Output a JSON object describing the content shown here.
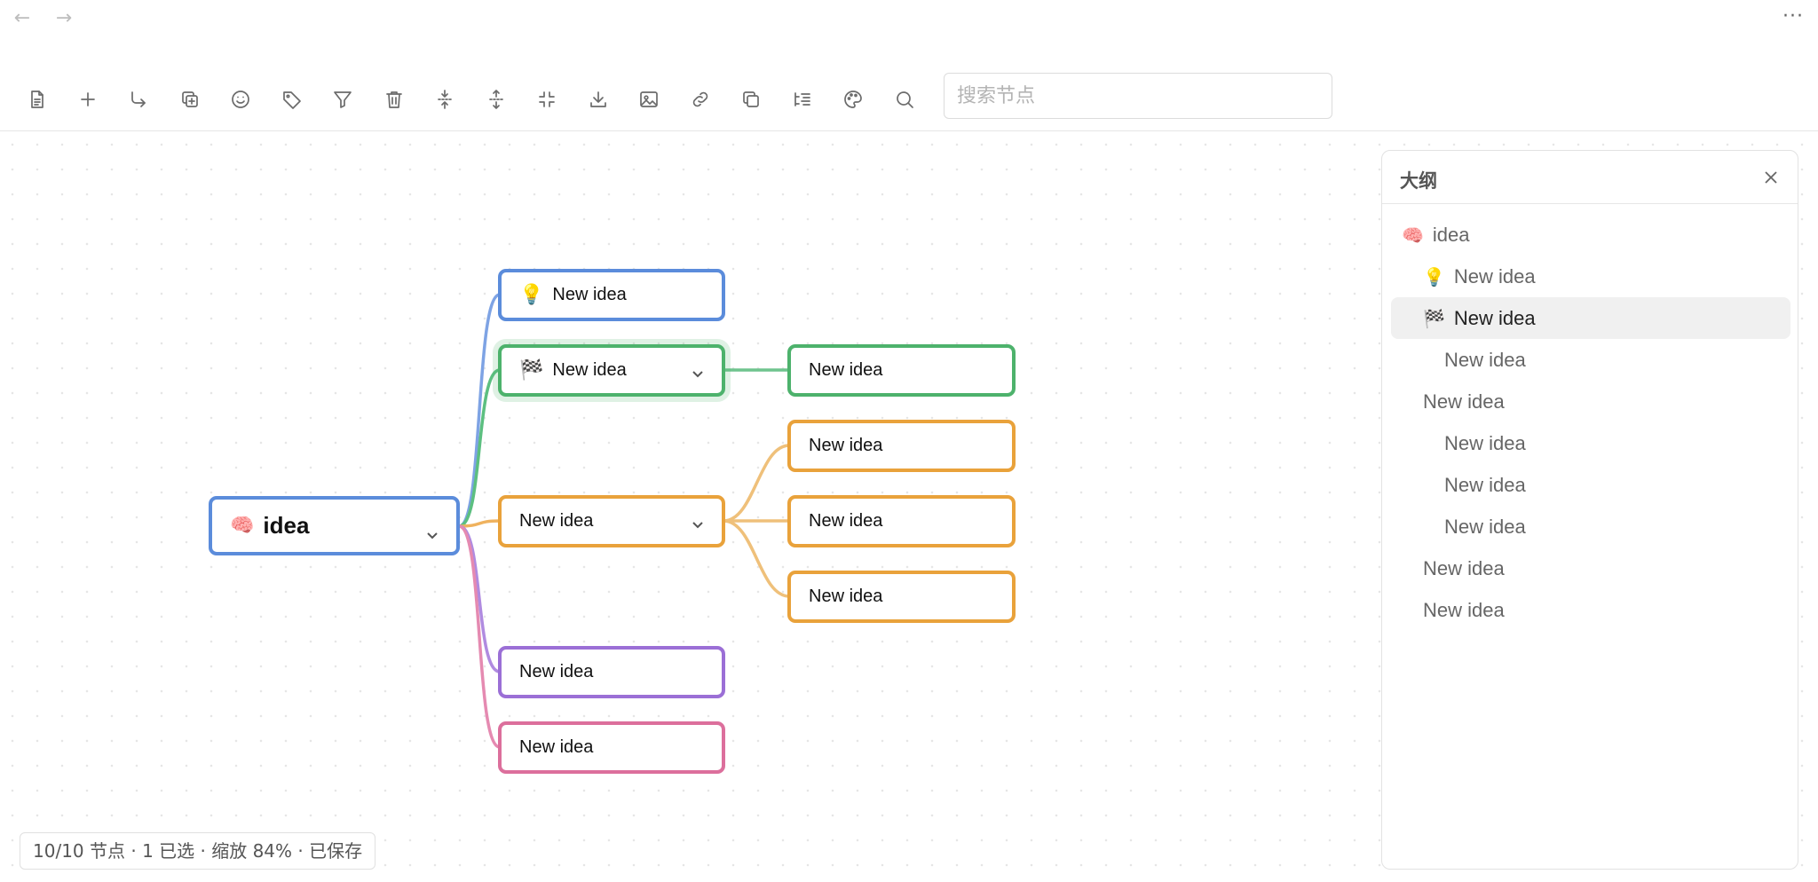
{
  "nav": {
    "back": "←",
    "forward": "→",
    "more": "···"
  },
  "toolbar": {
    "buttons": [
      {
        "name": "document-icon"
      },
      {
        "name": "add-icon"
      },
      {
        "name": "add-child-icon"
      },
      {
        "name": "duplicate-icon"
      },
      {
        "name": "emoji-icon"
      },
      {
        "name": "tag-icon"
      },
      {
        "name": "filter-icon"
      },
      {
        "name": "delete-icon"
      },
      {
        "name": "expand-icon"
      },
      {
        "name": "collapse-icon"
      },
      {
        "name": "fit-icon"
      },
      {
        "name": "download-icon"
      },
      {
        "name": "image-icon"
      },
      {
        "name": "link-icon"
      },
      {
        "name": "copy-icon"
      },
      {
        "name": "outline-icon"
      },
      {
        "name": "palette-icon"
      },
      {
        "name": "search-icon"
      }
    ],
    "search_placeholder": "搜索节点"
  },
  "mindmap": {
    "root": {
      "emoji": "🧠",
      "label": "idea",
      "color": "#5b8cdb"
    },
    "nodes": [
      {
        "emoji": "💡",
        "label": "New idea",
        "color": "#5b8cdb"
      },
      {
        "emoji": "🏁",
        "label": "New idea",
        "color": "#4db26c"
      },
      {
        "emoji": "",
        "label": "New idea",
        "color": "#e9a23b"
      },
      {
        "emoji": "",
        "label": "New idea",
        "color": "#9b6fd6"
      },
      {
        "emoji": "",
        "label": "New idea",
        "color": "#dc6f9c"
      },
      {
        "emoji": "",
        "label": "New idea",
        "color": "#4db26c"
      },
      {
        "emoji": "",
        "label": "New idea",
        "color": "#e9a23b"
      },
      {
        "emoji": "",
        "label": "New idea",
        "color": "#e9a23b"
      },
      {
        "emoji": "",
        "label": "New idea",
        "color": "#e9a23b"
      }
    ]
  },
  "outline": {
    "title": "大纲",
    "items": [
      {
        "emoji": "🧠",
        "label": "idea"
      },
      {
        "emoji": "💡",
        "label": "New idea"
      },
      {
        "emoji": "🏁",
        "label": "New idea",
        "active": true
      },
      {
        "emoji": "",
        "label": "New idea"
      },
      {
        "emoji": "",
        "label": "New idea"
      },
      {
        "emoji": "",
        "label": "New idea"
      },
      {
        "emoji": "",
        "label": "New idea"
      },
      {
        "emoji": "",
        "label": "New idea"
      },
      {
        "emoji": "",
        "label": "New idea"
      },
      {
        "emoji": "",
        "label": "New idea"
      }
    ]
  },
  "status": {
    "text": "10/10 节点 · 1 已选 · 缩放 84% · 已保存"
  }
}
